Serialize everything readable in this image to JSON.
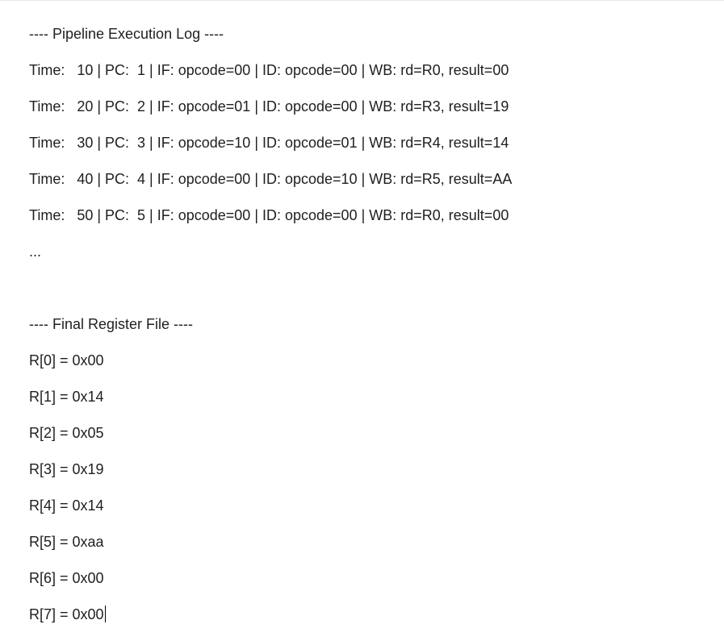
{
  "pipeline_header": "---- Pipeline Execution Log ----",
  "log_lines": [
    "Time:   10 | PC:  1 | IF: opcode=00 | ID: opcode=00 | WB: rd=R0, result=00",
    "Time:   20 | PC:  2 | IF: opcode=01 | ID: opcode=00 | WB: rd=R3, result=19",
    "Time:   30 | PC:  3 | IF: opcode=10 | ID: opcode=01 | WB: rd=R4, result=14",
    "Time:   40 | PC:  4 | IF: opcode=00 | ID: opcode=10 | WB: rd=R5, result=AA",
    "Time:   50 | PC:  5 | IF: opcode=00 | ID: opcode=00 | WB: rd=R0, result=00"
  ],
  "ellipsis": "...",
  "register_header": "---- Final Register File ----",
  "registers": [
    "R[0] = 0x00",
    "R[1] = 0x14",
    "R[2] = 0x05",
    "R[3] = 0x19",
    "R[4] = 0x14",
    "R[5] = 0xaa",
    "R[6] = 0x00",
    "R[7] = 0x00"
  ]
}
